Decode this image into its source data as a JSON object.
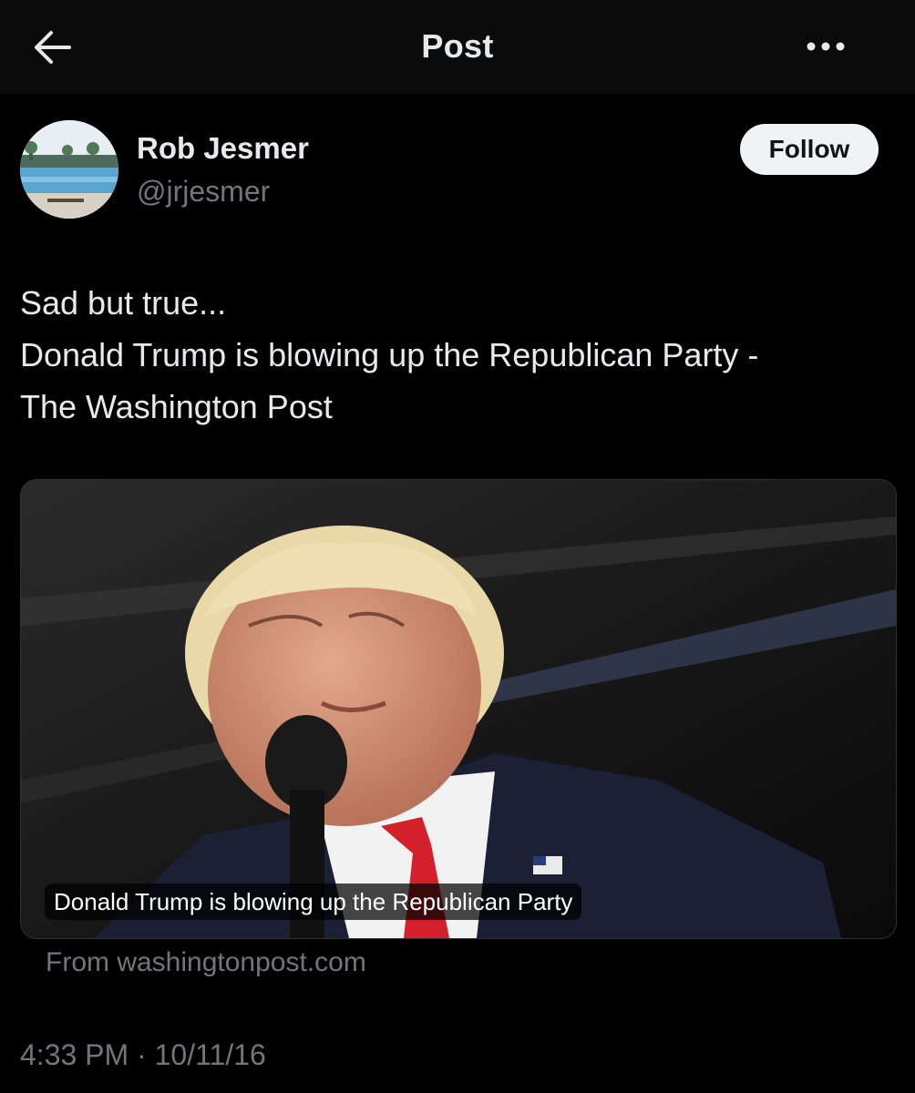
{
  "header": {
    "title": "Post",
    "back_icon": "back-arrow-icon",
    "more_icon": "more-horizontal-icon"
  },
  "author": {
    "name": "Rob Jesmer",
    "handle": "@jrjesmer",
    "follow_label": "Follow"
  },
  "post": {
    "lines": [
      "Sad but true...",
      "Donald Trump is blowing up the Republican Party -",
      "The Washington Post"
    ],
    "timestamp": "4:33 PM · 10/11/16"
  },
  "link_card": {
    "headline": "Donald Trump is blowing up the Republican Party",
    "domain": "From washingtonpost.com"
  },
  "colors": {
    "background": "#000000",
    "text": "#e7e9ea",
    "secondary_text": "#71767b",
    "follow_button_bg": "#eff3f4"
  }
}
